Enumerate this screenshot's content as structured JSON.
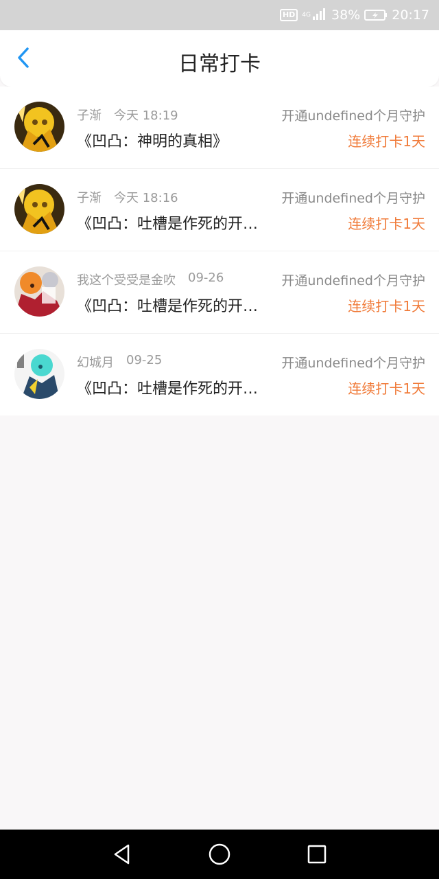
{
  "status_bar": {
    "hd": "HD",
    "network": "4G",
    "battery": "38%",
    "time": "20:17"
  },
  "header": {
    "title": "日常打卡",
    "back_icon": "chevron-left-icon"
  },
  "entries": [
    {
      "user": "子渐",
      "time": "今天 18:19",
      "guard": "开通undefined个月守护",
      "title": "《凹凸：神明的真相》",
      "streak": "连续打卡1天"
    },
    {
      "user": "子渐",
      "time": "今天 18:16",
      "guard": "开通undefined个月守护",
      "title": "《凹凸：吐槽是作死的开…",
      "streak": "连续打卡1天"
    },
    {
      "user": "我这个受受是金吹",
      "time": "09-26",
      "guard": "开通undefined个月守护",
      "title": "《凹凸：吐槽是作死的开…",
      "streak": "连续打卡1天"
    },
    {
      "user": "幻城月",
      "time": "09-25",
      "guard": "开通undefined个月守护",
      "title": "《凹凸：吐槽是作死的开…",
      "streak": "连续打卡1天"
    }
  ],
  "colors": {
    "accent": "#2196f3",
    "streak": "#f07a38",
    "background": "#f9f7f8"
  },
  "nav_bar": {
    "back": "triangle-back-icon",
    "home": "circle-home-icon",
    "recents": "square-recents-icon"
  }
}
